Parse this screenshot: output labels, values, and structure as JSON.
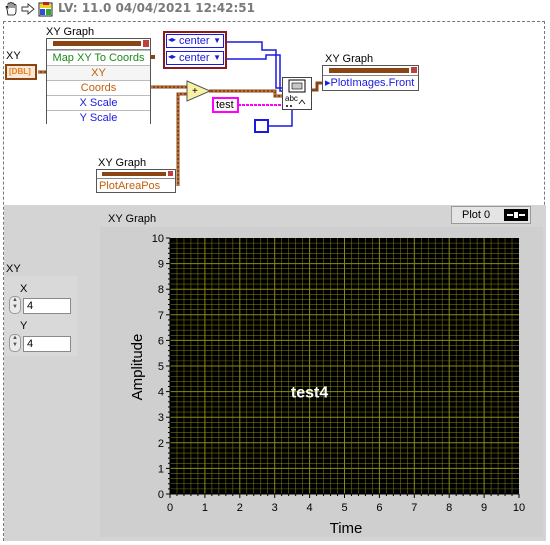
{
  "toolbar": {
    "version_text": "LV: 11.0 04/04/2021 12:42:51"
  },
  "block_diagram": {
    "xy_terminal": {
      "label": "XY",
      "value": "[DBL]"
    },
    "property_node": {
      "title": "XY Graph",
      "items": [
        "Map XY To Coords",
        "XY",
        "Coords",
        "X Scale",
        "Y Scale"
      ],
      "colors": [
        "#1a8a1a",
        "#c0600a",
        "#c0600a",
        "#1a1ae0",
        "#1a1ae0"
      ]
    },
    "align_ring_1": "center",
    "align_ring_2": "center",
    "string_const": "test",
    "plot_images_node": {
      "title": "XY Graph",
      "item": "PlotImages.Front"
    },
    "plot_area_node": {
      "title": "XY Graph",
      "item": "PlotAreaPos"
    },
    "add_symbol": "+"
  },
  "front_panel": {
    "xy_cluster": {
      "label": "XY",
      "x_label": "X",
      "x_value": "4",
      "y_label": "Y",
      "y_value": "4"
    },
    "graph": {
      "label": "XY Graph",
      "legend_label": "Plot 0",
      "overlay_text": "test4"
    }
  },
  "colors": {
    "plot_bg": "#000000",
    "grid": "#8a8a16",
    "dbl_wire": "#e87d1e",
    "cluster_wire": "#8b4513",
    "string_wire": "#ff00ff",
    "ref_wire": "#1a1ae0"
  },
  "chart_data": {
    "type": "line",
    "xlabel": "Time",
    "ylabel": "Amplitude",
    "xlim": [
      0,
      10
    ],
    "ylim": [
      0,
      10
    ],
    "x_ticks": [
      "0",
      "1",
      "2",
      "3",
      "4",
      "5",
      "6",
      "7",
      "8",
      "9",
      "10"
    ],
    "y_ticks": [
      "0",
      "1",
      "2",
      "3",
      "4",
      "5",
      "6",
      "7",
      "8",
      "9",
      "10"
    ],
    "minor_divisions": 5,
    "grid": true,
    "annotation": {
      "text": "test4",
      "x": 4,
      "y": 4
    },
    "series": []
  }
}
